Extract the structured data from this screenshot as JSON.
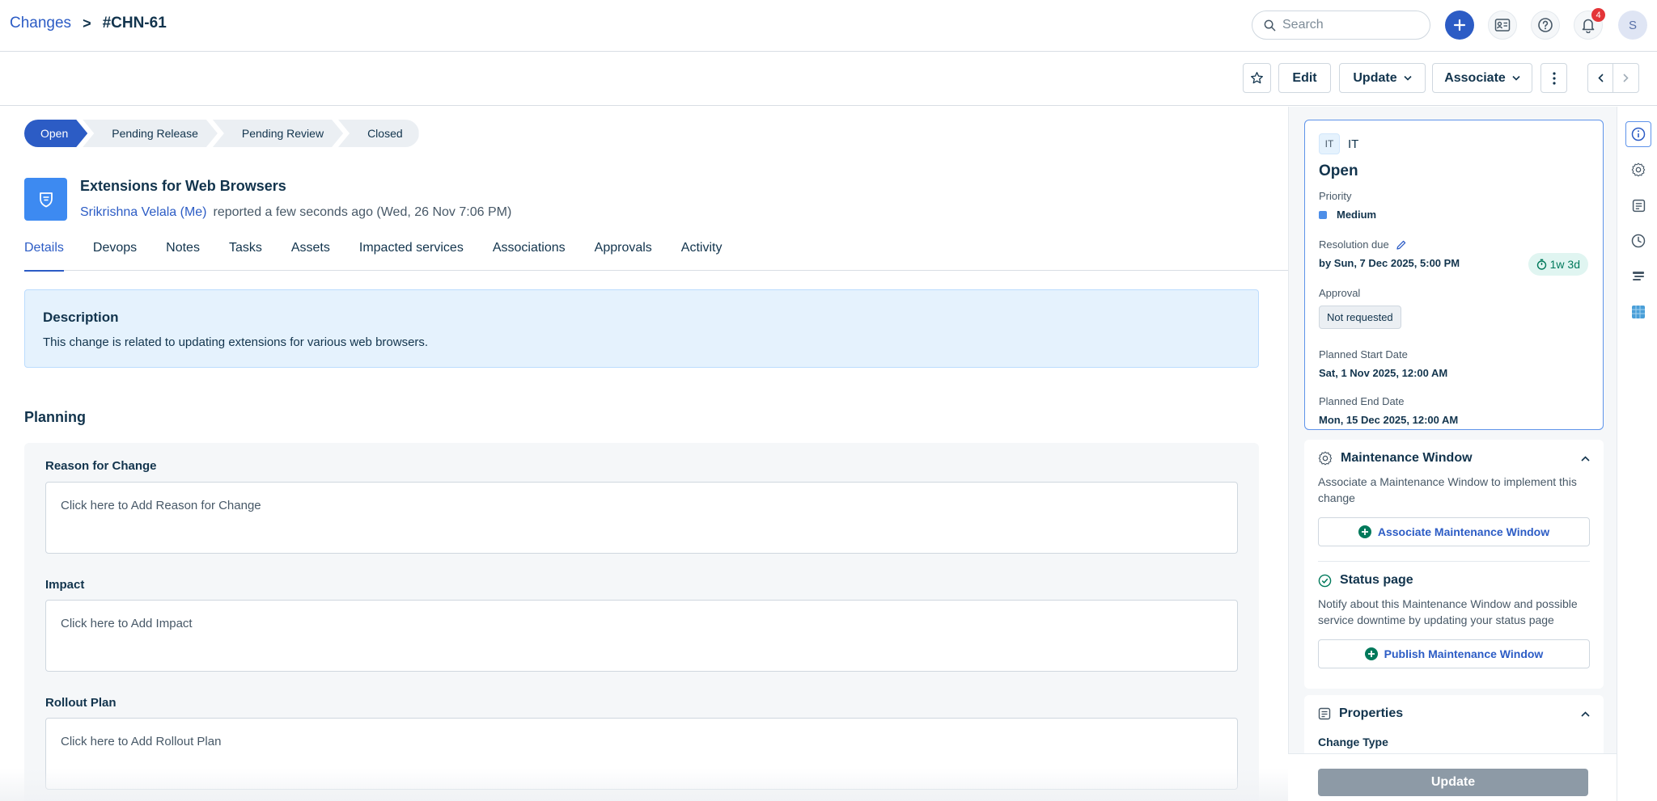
{
  "breadcrumb": {
    "parent": "Changes",
    "separator": ">",
    "current": "#CHN-61"
  },
  "search": {
    "placeholder": "Search"
  },
  "notifications": {
    "count": "4"
  },
  "user": {
    "initial": "S"
  },
  "actions": {
    "edit": "Edit",
    "update": "Update",
    "associate": "Associate"
  },
  "stages": [
    "Open",
    "Pending Release",
    "Pending Review",
    "Closed"
  ],
  "ticket": {
    "title": "Extensions for Web Browsers",
    "requester": "Srikrishna Velala (Me)",
    "reported": "reported a few seconds ago (Wed, 26 Nov 7:06 PM)"
  },
  "tabs": [
    "Details",
    "Devops",
    "Notes",
    "Tasks",
    "Assets",
    "Impacted services",
    "Associations",
    "Approvals",
    "Activity"
  ],
  "description": {
    "heading": "Description",
    "text": "This change is related to updating extensions for various web browsers."
  },
  "planning": {
    "heading": "Planning",
    "fields": [
      {
        "label": "Reason for Change",
        "placeholder": "Click here to Add Reason for Change"
      },
      {
        "label": "Impact",
        "placeholder": "Click here to Add Impact"
      },
      {
        "label": "Rollout Plan",
        "placeholder": "Click here to Add Rollout Plan"
      }
    ]
  },
  "summary": {
    "workspace_chip": "IT",
    "workspace": "IT",
    "status": "Open",
    "priority_label": "Priority",
    "priority": "Medium",
    "priority_color": "#4d8ee8",
    "resolution_label": "Resolution due",
    "resolution_value": "by Sun, 7 Dec 2025, 5:00 PM",
    "due_chip": "1w 3d",
    "approval_label": "Approval",
    "approval_value": "Not requested",
    "start_label": "Planned Start Date",
    "start_value": "Sat, 1 Nov 2025, 12:00 AM",
    "end_label": "Planned End Date",
    "end_value": "Mon, 15 Dec 2025, 12:00 AM"
  },
  "maintenance": {
    "title": "Maintenance Window",
    "text": "Associate a Maintenance Window to implement this change",
    "button": "Associate Maintenance Window"
  },
  "status_page": {
    "title": "Status page",
    "text": "Notify about this Maintenance Window and possible service downtime by updating your status page",
    "button": "Publish Maintenance Window"
  },
  "properties": {
    "title": "Properties",
    "first_field": "Change Type",
    "update_button": "Update"
  },
  "colors": {
    "accent": "#2c5cc5",
    "badge": "#e43538",
    "success": "#00795b"
  }
}
